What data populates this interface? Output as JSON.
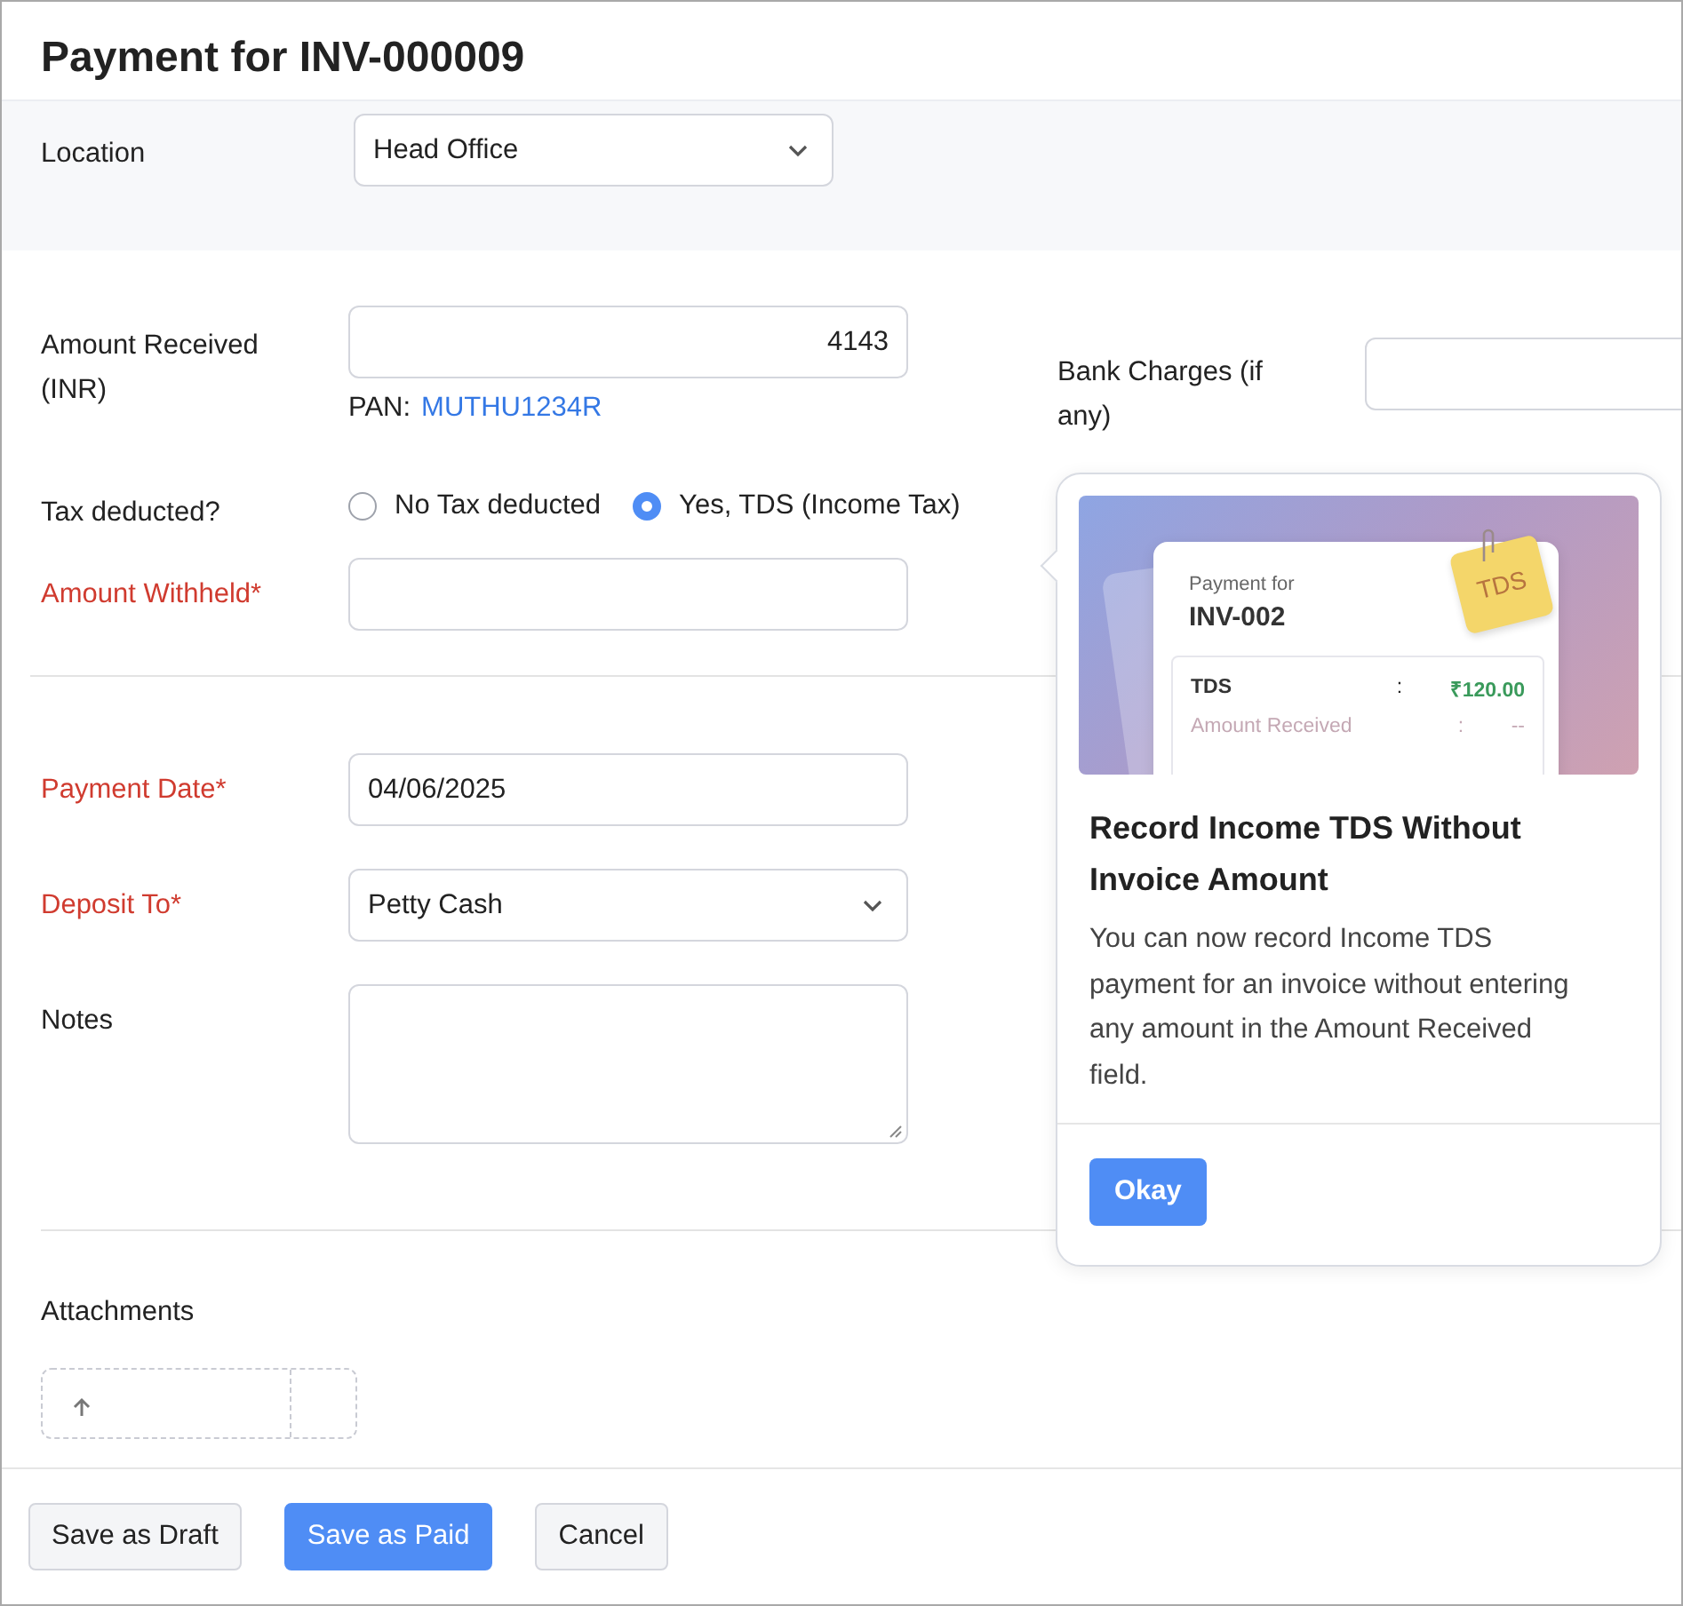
{
  "title": "Payment for INV-000009",
  "location": {
    "label": "Location",
    "value": "Head Office"
  },
  "amount_received": {
    "label": "Amount Received (INR)",
    "value": "4143",
    "pan_label": "PAN:",
    "pan": "MUTHU1234R"
  },
  "bank_charges": {
    "label": "Bank Charges (if any)"
  },
  "tax_deducted": {
    "label": "Tax deducted?",
    "options": [
      {
        "label": "No Tax deducted",
        "selected": false
      },
      {
        "label": "Yes, TDS (Income Tax)",
        "selected": true
      }
    ]
  },
  "amount_withheld": {
    "label": "Amount Withheld*",
    "required": true
  },
  "payment_date": {
    "label": "Payment Date*",
    "required": true,
    "value": "04/06/2025"
  },
  "deposit_to": {
    "label": "Deposit To*",
    "required": true,
    "value": "Petty Cash"
  },
  "notes": {
    "label": "Notes",
    "required": false
  },
  "attachments": {
    "label": "Attachments"
  },
  "buttons": [
    {
      "label": "Save as Draft",
      "kind": "secondary"
    },
    {
      "label": "Save as Paid",
      "kind": "primary"
    },
    {
      "label": "Cancel",
      "kind": "secondary"
    }
  ],
  "popover": {
    "illustration": {
      "caption": "Payment for",
      "invoice": "INV-002",
      "tag": "TDS",
      "rows": [
        {
          "label": "TDS",
          "separator": ":",
          "value": "₹120.00"
        },
        {
          "label": "Amount Received",
          "separator": ":",
          "value": "--"
        }
      ]
    },
    "title": "Record Income TDS Without Invoice Amount",
    "body": "You can now record Income TDS payment for an invoice without entering any amount in the Amount Received field.",
    "button": "Okay"
  }
}
